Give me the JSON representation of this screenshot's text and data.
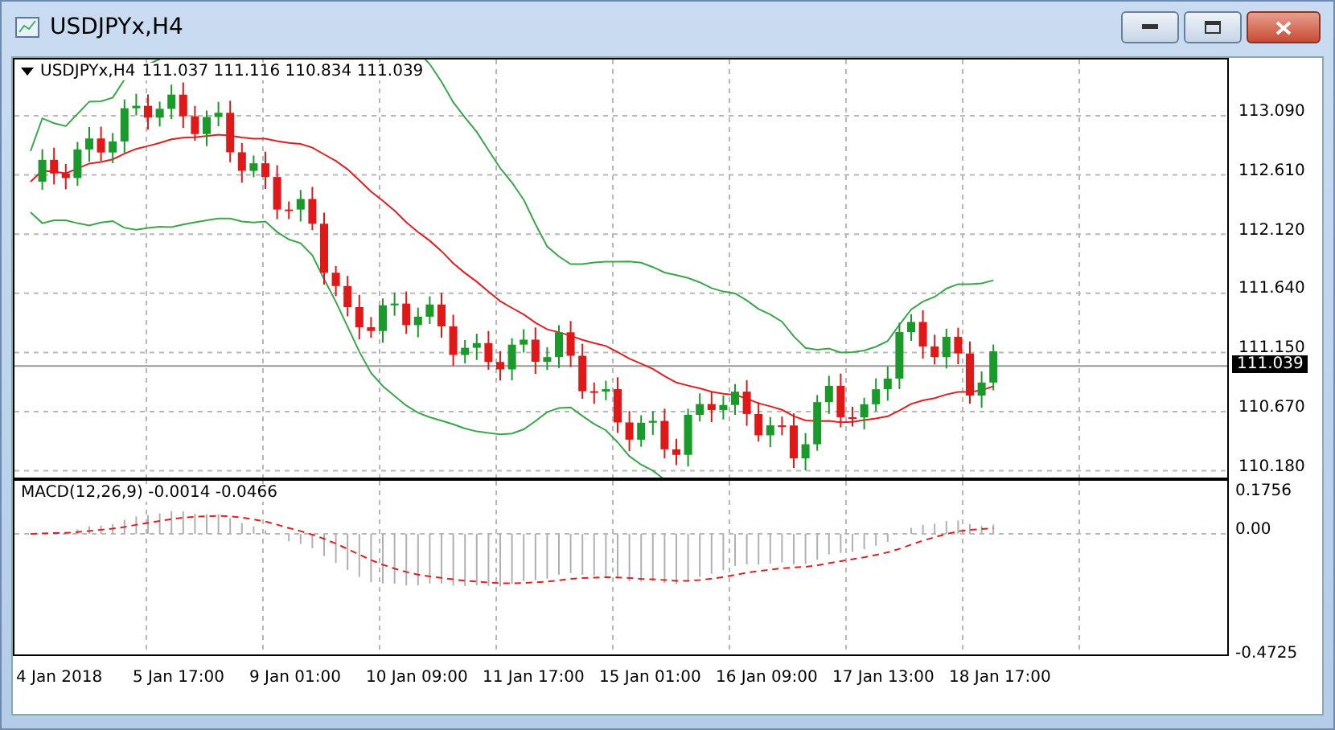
{
  "window": {
    "title": "USDJPYx,H4"
  },
  "chart_header": {
    "symbol": "USDJPYx,H4",
    "ohlc": "111.037 111.116 110.834 111.039"
  },
  "price_axis": {
    "labels": [
      "113.090",
      "112.610",
      "112.120",
      "111.640",
      "111.150",
      "110.670",
      "110.180"
    ],
    "current": "111.039"
  },
  "macd": {
    "label": "MACD(12,26,9) -0.0014 -0.0466",
    "labels": [
      "0.1756",
      "0.00",
      "-0.4725"
    ]
  },
  "time_axis": {
    "labels": [
      "4 Jan 2018",
      "5 Jan 17:00",
      "9 Jan 01:00",
      "10 Jan 09:00",
      "11 Jan 17:00",
      "15 Jan 01:00",
      "16 Jan 09:00",
      "17 Jan 13:00",
      "18 Jan 17:00"
    ]
  }
}
